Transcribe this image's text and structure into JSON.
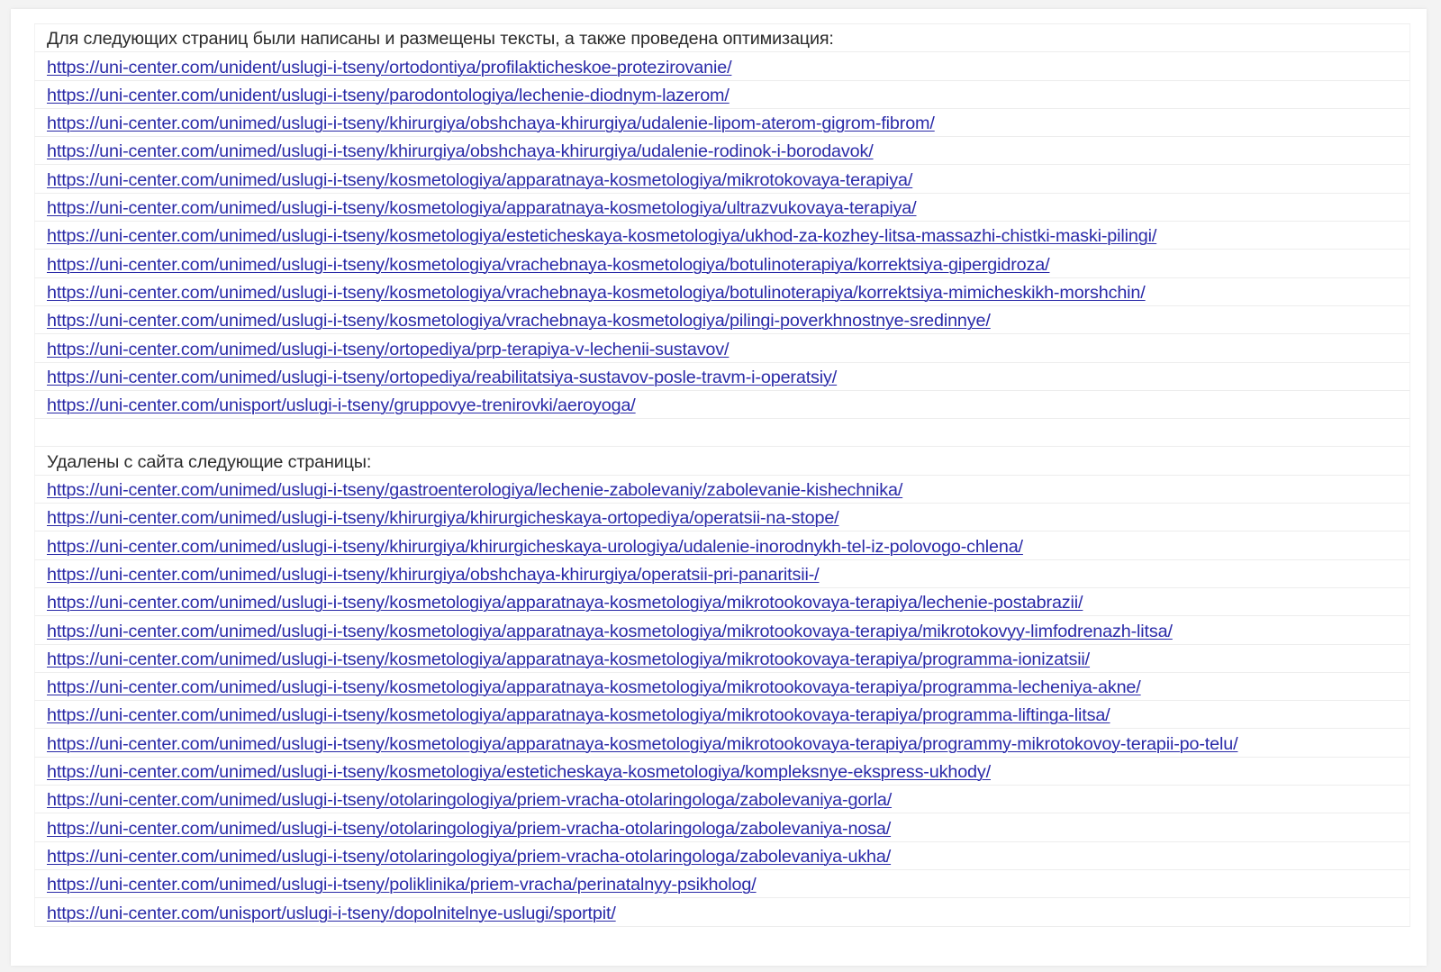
{
  "colors": {
    "link": "#2a2aa8",
    "text": "#2b2b2b",
    "background": "#ffffff"
  },
  "section_optimized": {
    "heading": "Для следующих страниц были написаны и размещены тексты, а также проведена оптимизация:",
    "links": [
      "https://uni-center.com/unident/uslugi-i-tseny/ortodontiya/profilakticheskoe-protezirovanie/",
      "https://uni-center.com/unident/uslugi-i-tseny/parodontologiya/lechenie-diodnym-lazerom/",
      "https://uni-center.com/unimed/uslugi-i-tseny/khirurgiya/obshchaya-khirurgiya/udalenie-lipom-aterom-gigrom-fibrom/",
      "https://uni-center.com/unimed/uslugi-i-tseny/khirurgiya/obshchaya-khirurgiya/udalenie-rodinok-i-borodavok/",
      "https://uni-center.com/unimed/uslugi-i-tseny/kosmetologiya/apparatnaya-kosmetologiya/mikrotokovaya-terapiya/",
      "https://uni-center.com/unimed/uslugi-i-tseny/kosmetologiya/apparatnaya-kosmetologiya/ultrazvukovaya-terapiya/",
      "https://uni-center.com/unimed/uslugi-i-tseny/kosmetologiya/esteticheskaya-kosmetologiya/ukhod-za-kozhey-litsa-massazhi-chistki-maski-pilingi/",
      "https://uni-center.com/unimed/uslugi-i-tseny/kosmetologiya/vrachebnaya-kosmetologiya/botulinoterapiya/korrektsiya-gipergidroza/",
      "https://uni-center.com/unimed/uslugi-i-tseny/kosmetologiya/vrachebnaya-kosmetologiya/botulinoterapiya/korrektsiya-mimicheskikh-morshchin/",
      "https://uni-center.com/unimed/uslugi-i-tseny/kosmetologiya/vrachebnaya-kosmetologiya/pilingi-poverkhnostnye-sredinnye/",
      "https://uni-center.com/unimed/uslugi-i-tseny/ortopediya/prp-terapiya-v-lechenii-sustavov/",
      "https://uni-center.com/unimed/uslugi-i-tseny/ortopediya/reabilitatsiya-sustavov-posle-travm-i-operatsiy/",
      "https://uni-center.com/unisport/uslugi-i-tseny/gruppovye-trenirovki/aeroyoga/"
    ]
  },
  "section_removed": {
    "heading": "Удалены с сайта следующие страницы:",
    "links": [
      "https://uni-center.com/unimed/uslugi-i-tseny/gastroenterologiya/lechenie-zabolevaniy/zabolevanie-kishechnika/",
      "https://uni-center.com/unimed/uslugi-i-tseny/khirurgiya/khirurgicheskaya-ortopediya/operatsii-na-stope/",
      "https://uni-center.com/unimed/uslugi-i-tseny/khirurgiya/khirurgicheskaya-urologiya/udalenie-inorodnykh-tel-iz-polovogo-chlena/",
      "https://uni-center.com/unimed/uslugi-i-tseny/khirurgiya/obshchaya-khirurgiya/operatsii-pri-panaritsii-/",
      "https://uni-center.com/unimed/uslugi-i-tseny/kosmetologiya/apparatnaya-kosmetologiya/mikrotookovaya-terapiya/lechenie-postabrazii/",
      "https://uni-center.com/unimed/uslugi-i-tseny/kosmetologiya/apparatnaya-kosmetologiya/mikrotookovaya-terapiya/mikrotokovyy-limfodrenazh-litsa/",
      "https://uni-center.com/unimed/uslugi-i-tseny/kosmetologiya/apparatnaya-kosmetologiya/mikrotookovaya-terapiya/programma-ionizatsii/",
      "https://uni-center.com/unimed/uslugi-i-tseny/kosmetologiya/apparatnaya-kosmetologiya/mikrotookovaya-terapiya/programma-lecheniya-akne/",
      "https://uni-center.com/unimed/uslugi-i-tseny/kosmetologiya/apparatnaya-kosmetologiya/mikrotookovaya-terapiya/programma-liftinga-litsa/",
      "https://uni-center.com/unimed/uslugi-i-tseny/kosmetologiya/apparatnaya-kosmetologiya/mikrotookovaya-terapiya/programmy-mikrotokovoy-terapii-po-telu/",
      "https://uni-center.com/unimed/uslugi-i-tseny/kosmetologiya/esteticheskaya-kosmetologiya/kompleksnye-ekspress-ukhody/",
      "https://uni-center.com/unimed/uslugi-i-tseny/otolaringologiya/priem-vracha-otolaringologa/zabolevaniya-gorla/",
      "https://uni-center.com/unimed/uslugi-i-tseny/otolaringologiya/priem-vracha-otolaringologa/zabolevaniya-nosa/",
      "https://uni-center.com/unimed/uslugi-i-tseny/otolaringologiya/priem-vracha-otolaringologa/zabolevaniya-ukha/",
      "https://uni-center.com/unimed/uslugi-i-tseny/poliklinika/priem-vracha/perinatalnyy-psikholog/",
      "https://uni-center.com/unisport/uslugi-i-tseny/dopolnitelnye-uslugi/sportpit/"
    ]
  }
}
